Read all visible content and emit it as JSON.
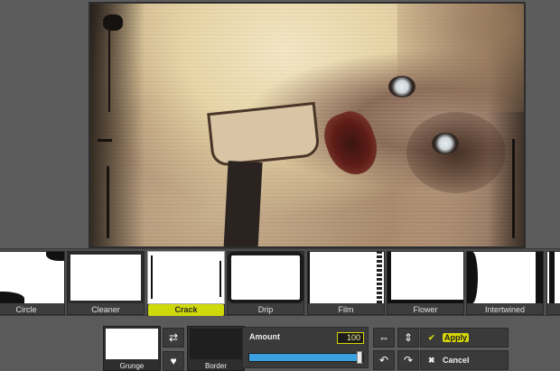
{
  "frames": [
    {
      "label": "Circle",
      "selected": false
    },
    {
      "label": "Cleaner",
      "selected": false
    },
    {
      "label": "Crack",
      "selected": true
    },
    {
      "label": "Drip",
      "selected": false
    },
    {
      "label": "Film",
      "selected": false
    },
    {
      "label": "Flower",
      "selected": false
    },
    {
      "label": "Intertwined",
      "selected": false
    },
    {
      "label": "",
      "selected": false
    }
  ],
  "toolbar": {
    "preset_label": "Grunge",
    "border_label": "Border",
    "amount_label": "Amount",
    "amount_value": "100",
    "amount_fraction": 1.0,
    "apply_label": "Apply",
    "cancel_label": "Cancel",
    "icons": {
      "shuffle": "shuffle-icon",
      "favorite": "heart-icon",
      "flip_h": "flip-horizontal-icon",
      "flip_v": "flip-vertical-icon",
      "rotate_left": "rotate-left-icon",
      "rotate_right": "rotate-right-icon",
      "apply": "check-icon",
      "cancel": "close-icon"
    }
  },
  "colors": {
    "accent": "#d6d60a",
    "slider": "#3aa0e0",
    "background": "#5a5a5a"
  }
}
